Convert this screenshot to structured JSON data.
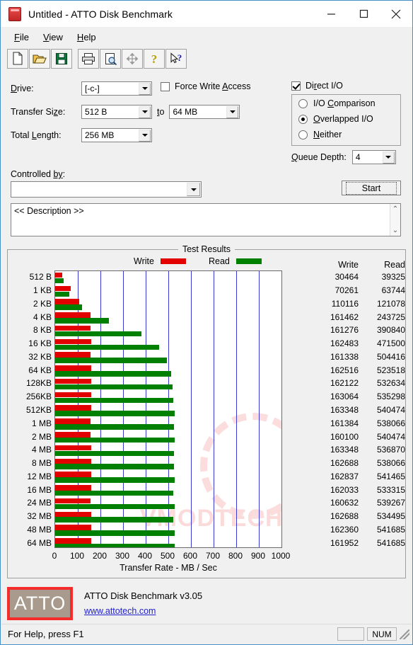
{
  "window": {
    "title": "Untitled - ATTO Disk Benchmark",
    "icon": "disk-icon",
    "minimize": "—",
    "maximize": "☐",
    "close": "✕"
  },
  "menu": {
    "items": [
      "File",
      "View",
      "Help"
    ]
  },
  "toolbar": {
    "buttons": [
      {
        "name": "new-file-icon"
      },
      {
        "name": "open-folder-icon"
      },
      {
        "name": "save-disk-icon"
      },
      {
        "name": "print-icon"
      },
      {
        "name": "print-preview-icon"
      },
      {
        "name": "move-icon"
      },
      {
        "name": "help-question-icon"
      },
      {
        "name": "context-help-icon"
      }
    ]
  },
  "controls": {
    "drive_label": "Drive:",
    "drive_value": "[-c-]",
    "transfer_size_label": "Transfer Size:",
    "transfer_size_from": "512 B",
    "transfer_size_to_label": "to",
    "transfer_size_to": "64 MB",
    "total_length_label": "Total Length:",
    "total_length_value": "256 MB",
    "force_write_label": "Force Write Access",
    "force_write_checked": false,
    "direct_io_label": "Direct I/O",
    "direct_io_checked": true,
    "io_modes": [
      {
        "label": "I/O Comparison",
        "selected": false
      },
      {
        "label": "Overlapped I/O",
        "selected": true
      },
      {
        "label": "Neither",
        "selected": false
      }
    ],
    "queue_depth_label": "Queue Depth:",
    "queue_depth_value": "4",
    "controlled_by_label": "Controlled by:",
    "controlled_by_value": "",
    "start_label": "Start",
    "description_value": "<< Description >>",
    "scroll_up": "⌃",
    "scroll_down": "⌄"
  },
  "results": {
    "group_title": "Test Results",
    "legend": [
      {
        "label": "Write",
        "color": "#e20000"
      },
      {
        "label": "Read",
        "color": "#008000"
      }
    ],
    "col_write": "Write",
    "col_read": "Read",
    "watermark": "VMODTECH.COM"
  },
  "chart_data": {
    "type": "bar",
    "title": "Test Results",
    "xlabel": "Transfer Rate - MB / Sec",
    "ylabel": "",
    "orientation": "horizontal",
    "grid": true,
    "legend_position": "top",
    "xlim": [
      0,
      1000
    ],
    "xticks": [
      0,
      100,
      200,
      300,
      400,
      500,
      600,
      700,
      800,
      900,
      1000
    ],
    "categories": [
      "512 B",
      "1 KB",
      "2 KB",
      "4 KB",
      "8 KB",
      "16 KB",
      "32 KB",
      "64 KB",
      "128KB",
      "256KB",
      "512KB",
      "1 MB",
      "2 MB",
      "4 MB",
      "8 MB",
      "12 MB",
      "16 MB",
      "24 MB",
      "32 MB",
      "48 MB",
      "64 MB"
    ],
    "value_units": "KB/s",
    "series": [
      {
        "name": "Write",
        "color": "#e20000",
        "values": [
          30464,
          70261,
          110116,
          161462,
          161276,
          162483,
          161338,
          162516,
          162122,
          163064,
          163348,
          161384,
          160100,
          163348,
          162688,
          162837,
          162033,
          160632,
          162688,
          162360,
          161952
        ]
      },
      {
        "name": "Read",
        "color": "#008000",
        "values": [
          39325,
          63744,
          121078,
          243725,
          390840,
          471500,
          504416,
          523518,
          532634,
          535298,
          540474,
          538066,
          540474,
          536870,
          538066,
          541465,
          533315,
          539267,
          534495,
          541685,
          541685
        ]
      }
    ]
  },
  "footer": {
    "logo_text": "ATTO",
    "product": "ATTO Disk Benchmark v3.05",
    "url": "www.attotech.com"
  },
  "statusbar": {
    "help_text": "For Help, press F1",
    "num_text": "NUM"
  }
}
